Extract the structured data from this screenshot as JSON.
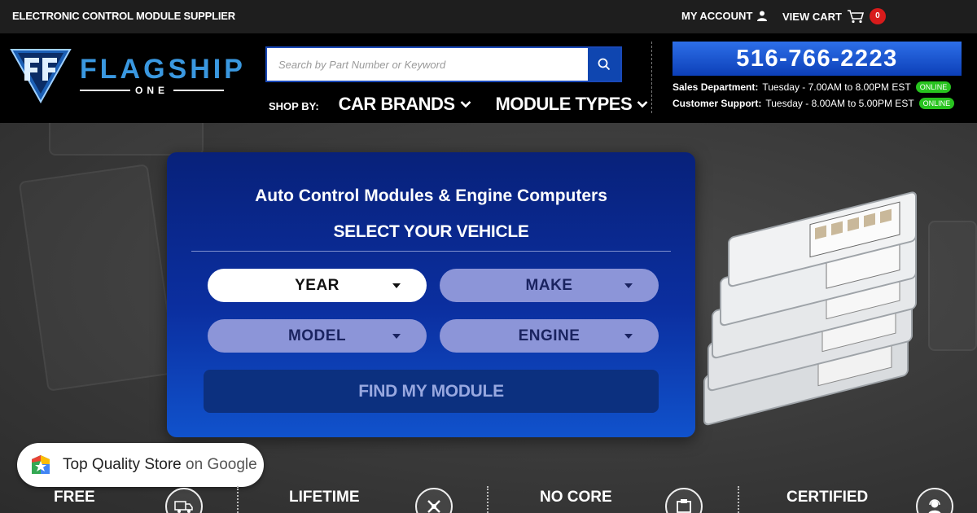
{
  "topbar": {
    "tagline": "ELECTRONIC CONTROL MODULE SUPPLIER",
    "account_label": "MY ACCOUNT",
    "cart_label": "VIEW CART",
    "cart_count": "0"
  },
  "logo": {
    "word": "FLAGSHIP",
    "sub": "ONE"
  },
  "search": {
    "placeholder": "Search by Part Number or Keyword"
  },
  "nav": {
    "shop_by": "SHOP BY:",
    "car_brands": "CAR BRANDS",
    "module_types": "MODULE TYPES"
  },
  "contact": {
    "phone": "516-766-2223",
    "sales_label": "Sales Department:",
    "sales_hours": "Tuesday - 7.00AM to 8.00PM EST",
    "support_label": "Customer Support:",
    "support_hours": "Tuesday - 8.00AM to 5.00PM EST",
    "status": "ONLINE"
  },
  "finder": {
    "title": "Auto Control Modules & Engine Computers",
    "subtitle": "SELECT YOUR VEHICLE",
    "year": "YEAR",
    "make": "MAKE",
    "model": "MODEL",
    "engine": "ENGINE",
    "find_button": "FIND MY MODULE"
  },
  "badge": {
    "text_main": "Top Quality Store",
    "text_on": "on Google"
  },
  "features": {
    "free": "FREE",
    "lifetime": "LIFETIME",
    "no_core": "NO CORE",
    "certified": "CERTIFIED"
  },
  "colors": {
    "brand_blue": "#0f46b0",
    "logo_blue": "#3a98e0",
    "online_green": "#28c31f",
    "cart_red": "#d81b1b"
  }
}
